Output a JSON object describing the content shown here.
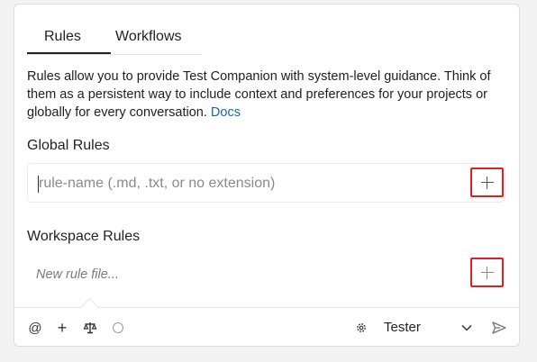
{
  "tabs": [
    {
      "label": "Rules",
      "active": true
    },
    {
      "label": "Workflows",
      "active": false
    }
  ],
  "description": {
    "text": "Rules allow you to provide Test Companion with system-level guidance. Think of them as a persistent way to include context and preferences for your projects or globally for every conversation.",
    "link_label": "Docs"
  },
  "global_rules": {
    "title": "Global Rules",
    "input_value": "",
    "input_placeholder": "rule-name (.md, .txt, or no extension)"
  },
  "workspace_rules": {
    "title": "Workspace Rules",
    "new_rule_placeholder": "New rule file..."
  },
  "footer": {
    "at_symbol": "@",
    "add_symbol": "+",
    "model_selector_label": "Tester"
  },
  "icons": [
    "plus-icon",
    "at-icon",
    "scale-icon",
    "circle-icon",
    "gear-icon",
    "chevron-down-icon",
    "send-icon"
  ],
  "colors": {
    "accent_link": "#1a65b8",
    "highlight_border": "#e02020",
    "panel_background": "#ffffff",
    "page_background": "#f3f3f3"
  }
}
